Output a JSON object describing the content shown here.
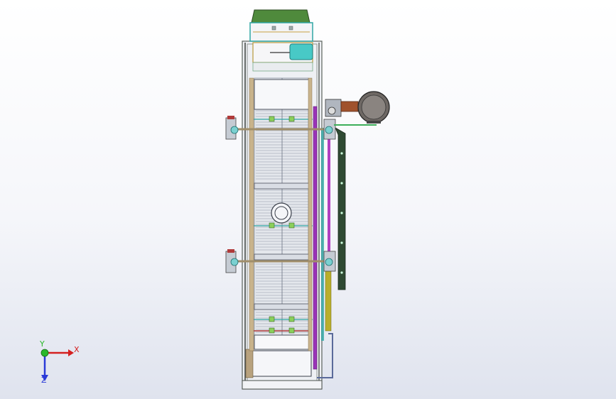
{
  "triad": {
    "x_label": "X",
    "y_label": "Y",
    "z_label": "Z",
    "x_color": "#d42020",
    "y_color": "#2ab82a",
    "z_color": "#2a3ad8"
  },
  "colors": {
    "frame": "#6e7670",
    "frame_fill": "#e6e9ee",
    "green_cover": "#4f8a3c",
    "teal": "#2ea6a4",
    "cyan_cylinder": "#48c9c6",
    "tan_rail": "#b8a27e",
    "purple_chain": "#9a33b8",
    "olive_chain": "#b9ae2c",
    "dark_green_bar": "#2f4a33",
    "motor_body": "#7a7470",
    "motor_copper": "#a0522d",
    "red_clamp": "#b03a3a",
    "slat": "#cfd4dc",
    "slat_line": "#8a94a3"
  }
}
